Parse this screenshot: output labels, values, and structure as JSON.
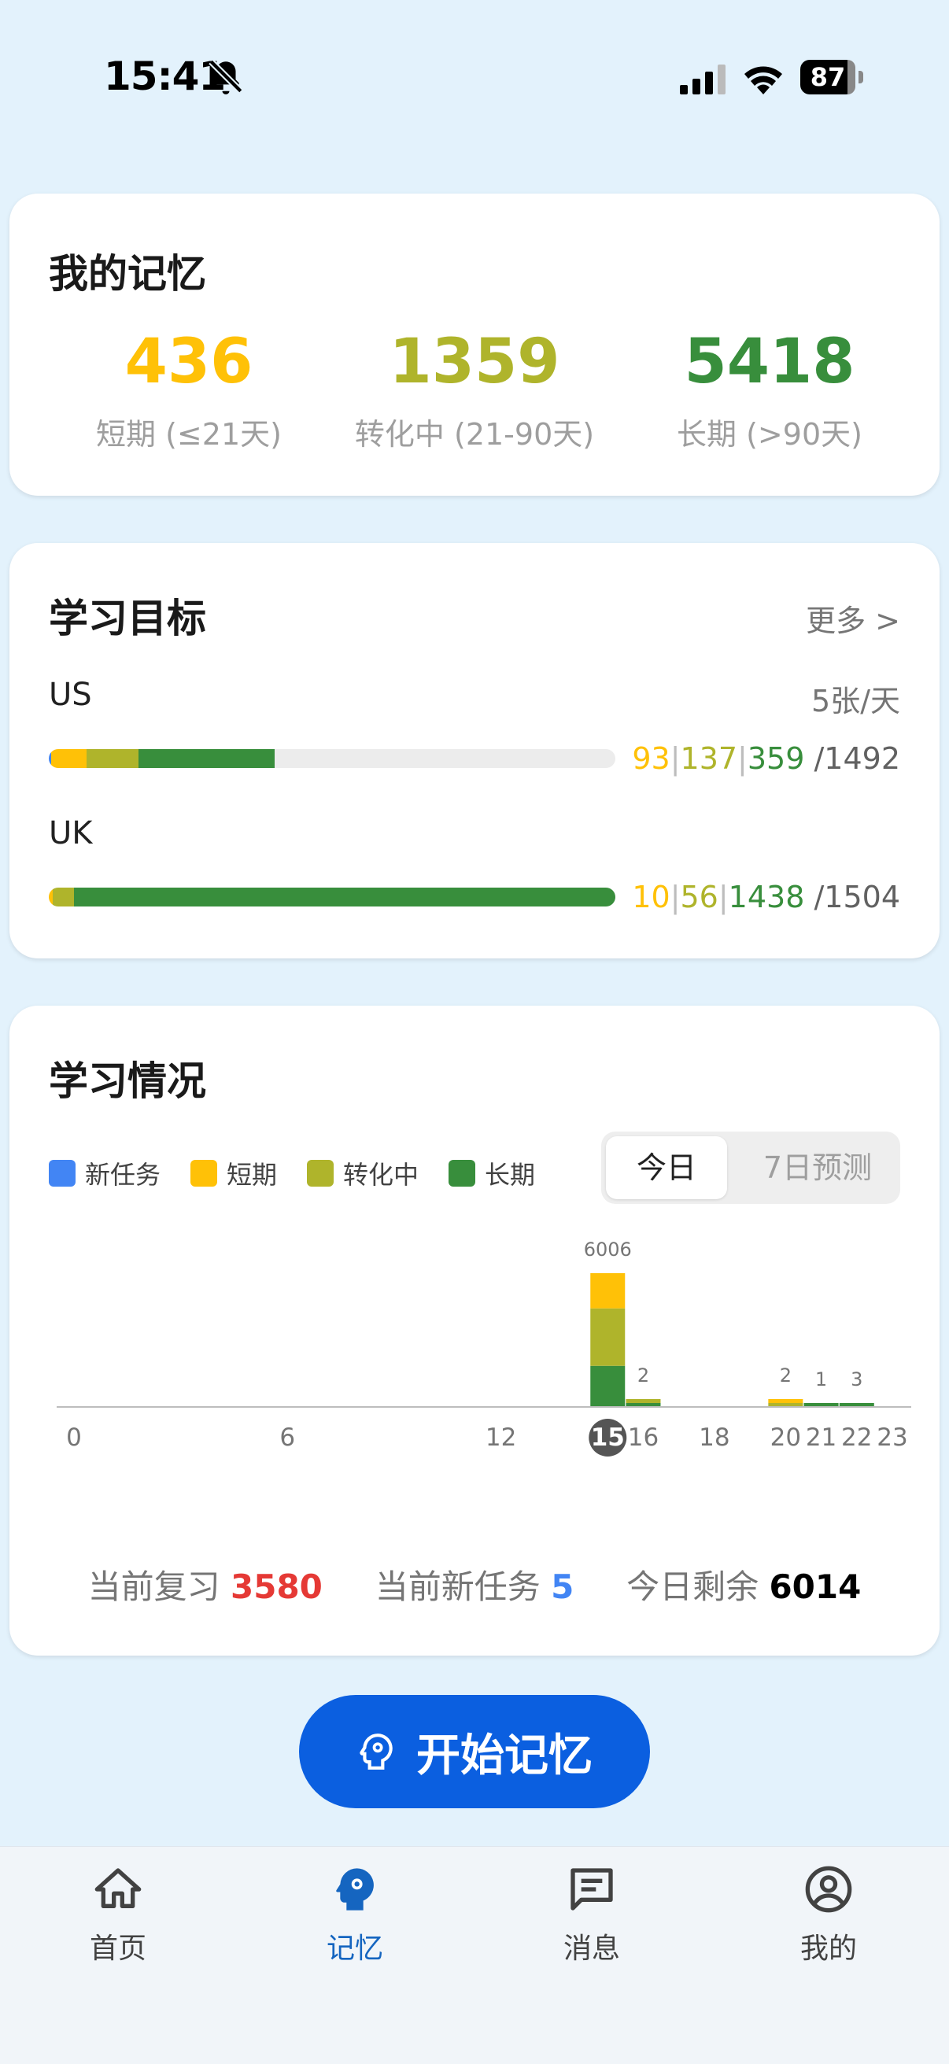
{
  "status_bar": {
    "time": "15:41",
    "battery": "87"
  },
  "memory": {
    "title": "我的记忆",
    "stats": [
      {
        "value": "436",
        "label": "短期 (≤21天)",
        "color": "#FFC107"
      },
      {
        "value": "1359",
        "label": "转化中 (21-90天)",
        "color": "#AFB42B"
      },
      {
        "value": "5418",
        "label": "长期 (>90天)",
        "color": "#388E3C"
      }
    ]
  },
  "goals": {
    "title": "学习目标",
    "more": "更多 >",
    "items": [
      {
        "name": "US",
        "rate": "5张/天",
        "short": "93",
        "transition": "137",
        "long": "359",
        "total": "/1492",
        "blue_ratio": 0.004,
        "short_ratio": 0.0623,
        "transition_ratio": 0.0918,
        "long_ratio": 0.2406
      },
      {
        "name": "UK",
        "rate": "",
        "short": "10",
        "transition": "56",
        "long": "1438",
        "total": "/1504",
        "blue_ratio": 0.0,
        "short_ratio": 0.0066,
        "transition_ratio": 0.0372,
        "long_ratio": 0.9561
      }
    ]
  },
  "study": {
    "title": "学习情况",
    "legend": [
      {
        "label": "新任务",
        "color": "#4285F4"
      },
      {
        "label": "短期",
        "color": "#FFC107"
      },
      {
        "label": "转化中",
        "color": "#AFB42B"
      },
      {
        "label": "长期",
        "color": "#388E3C"
      }
    ],
    "toggle": {
      "active": "今日",
      "inactive": "7日预测"
    },
    "summary": {
      "review_label": "当前复习",
      "review_value": "3580",
      "new_label": "当前新任务",
      "new_value": "5",
      "remaining_label": "今日剩余",
      "remaining_value": "6014"
    }
  },
  "chart_data": {
    "type": "bar",
    "stacked": true,
    "x": [
      15,
      16,
      20,
      21,
      22
    ],
    "series": [
      {
        "name": "短期",
        "color": "#FFC107",
        "values": [
          1580,
          0,
          1,
          0,
          0
        ]
      },
      {
        "name": "转化中",
        "color": "#AFB42B",
        "values": [
          2580,
          1,
          1,
          0,
          0
        ]
      },
      {
        "name": "长期",
        "color": "#388E3C",
        "values": [
          1846,
          1,
          0,
          1,
          3
        ]
      }
    ],
    "totals": [
      "6006",
      "2",
      "2",
      "1",
      "3"
    ],
    "xlim": [
      0,
      23
    ],
    "x_ticks": [
      "0",
      "6",
      "12",
      "15",
      "16",
      "18",
      "20",
      "21",
      "22",
      "23"
    ],
    "highlight_tick": "15"
  },
  "start_button": {
    "label": "开始记忆"
  },
  "nav": {
    "items": [
      {
        "label": "首页"
      },
      {
        "label": "记忆"
      },
      {
        "label": "消息"
      },
      {
        "label": "我的"
      }
    ]
  }
}
